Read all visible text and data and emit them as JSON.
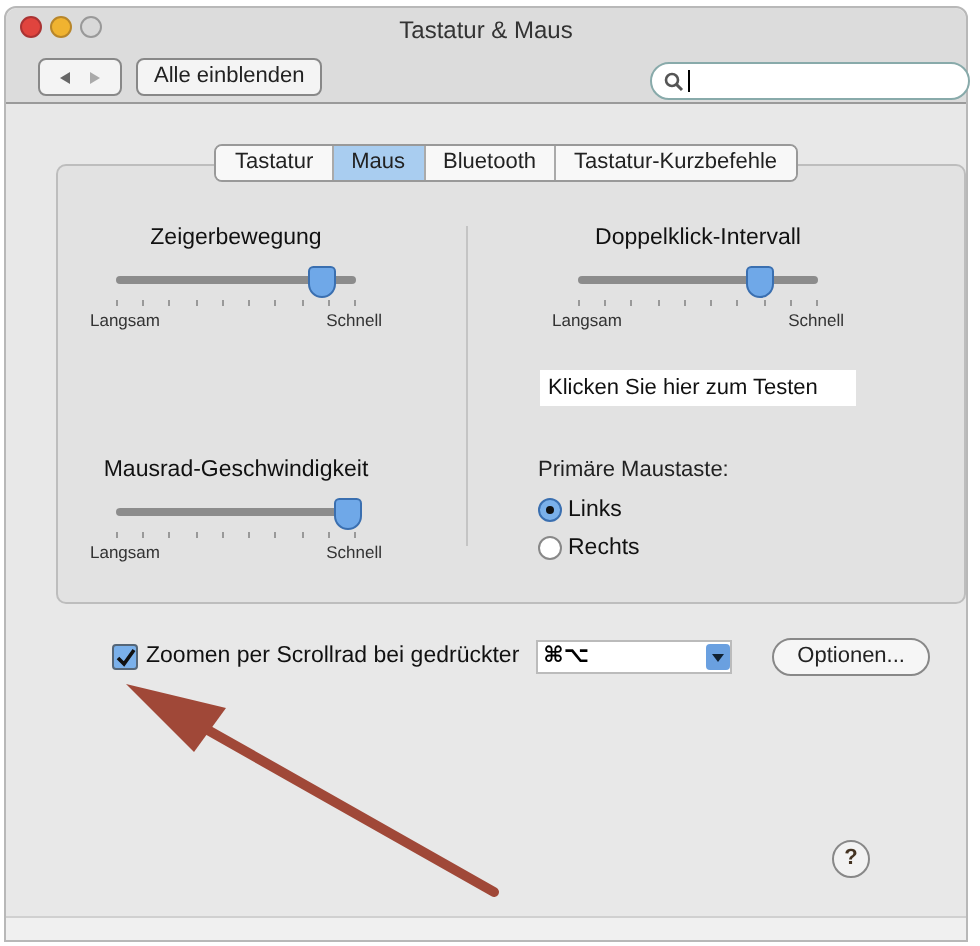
{
  "window": {
    "title": "Tastatur & Maus"
  },
  "toolbar": {
    "show_all": "Alle einblenden"
  },
  "tabs": [
    {
      "label": "Tastatur",
      "selected": false
    },
    {
      "label": "Maus",
      "selected": true
    },
    {
      "label": "Bluetooth",
      "selected": false
    },
    {
      "label": "Tastatur-Kurzbefehle",
      "selected": false
    }
  ],
  "sliders": [
    {
      "title": "Zeigerbewegung",
      "level": 0.86,
      "min_label": "Langsam",
      "max_label": "Schnell"
    },
    {
      "title": "Mausrad-Geschwindigkeit",
      "level": 0.97,
      "min_label": "Langsam",
      "max_label": "Schnell"
    },
    {
      "title": "Doppelklick-Intervall",
      "level": 0.76,
      "min_label": "Langsam",
      "max_label": "Schnell"
    }
  ],
  "test_area": "Klicken Sie hier zum Testen",
  "primary_button": {
    "label": "Primäre Maustaste:",
    "options": [
      {
        "label": "Links",
        "selected": true
      },
      {
        "label": "Rechts",
        "selected": false
      }
    ]
  },
  "zoom": {
    "checked": true,
    "label": "Zoomen per Scrollrad bei gedrückter",
    "modifier": "⌘⌥",
    "options_button": "Optionen..."
  },
  "help": "?"
}
